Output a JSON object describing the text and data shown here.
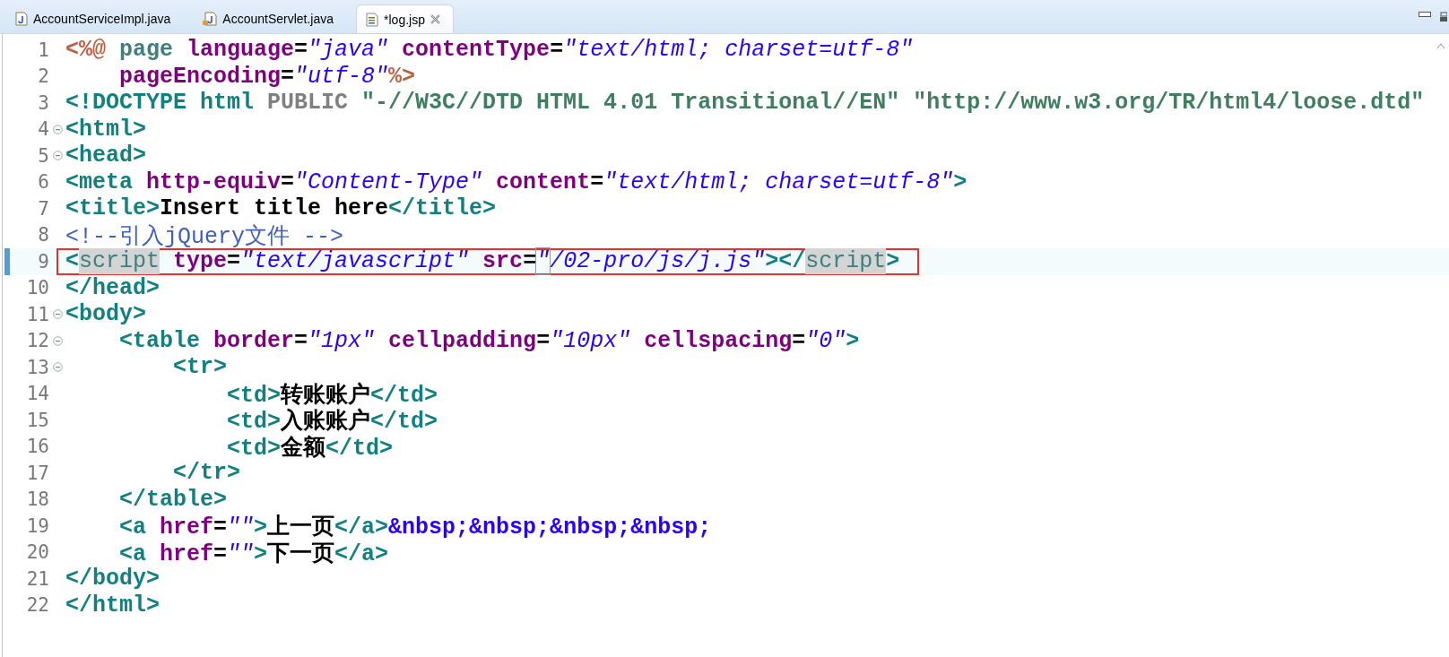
{
  "tabs": [
    {
      "label": "AccountServiceImpl.java",
      "kind": "java",
      "selected": false
    },
    {
      "label": "AccountServlet.java",
      "kind": "servlet",
      "selected": false
    },
    {
      "label": "*log.jsp",
      "kind": "jsp",
      "selected": true
    }
  ],
  "editor": {
    "lines": [
      {
        "number": "1",
        "collapsible": false,
        "current": false,
        "boxed": false,
        "tokens": [
          {
            "kind": "directive",
            "text": "<%@"
          },
          {
            "kind": "name",
            "text": " page"
          },
          {
            "kind": "attr",
            "text": " language"
          },
          {
            "kind": "punct",
            "text": "="
          },
          {
            "kind": "string",
            "text": "\"java\""
          },
          {
            "kind": "attr",
            "text": " contentType"
          },
          {
            "kind": "punct",
            "text": "="
          },
          {
            "kind": "string",
            "text": "\"text/html; charset=utf-8\""
          }
        ]
      },
      {
        "number": "2",
        "collapsible": false,
        "current": false,
        "boxed": false,
        "tokens": [
          {
            "kind": "attr",
            "text": "    pageEncoding"
          },
          {
            "kind": "punct",
            "text": "="
          },
          {
            "kind": "string",
            "text": "\"utf-8\""
          },
          {
            "kind": "directive",
            "text": "%>"
          }
        ]
      },
      {
        "number": "3",
        "collapsible": false,
        "current": false,
        "boxed": false,
        "tokens": [
          {
            "kind": "tag",
            "text": "<!DOCTYPE html"
          },
          {
            "kind": "keyword",
            "text": " PUBLIC"
          },
          {
            "kind": "doctype-string",
            "text": " \"-//W3C//DTD HTML 4.01 Transitional//EN\" \"http://www.w3.org/TR/html4/loose.dtd\""
          }
        ]
      },
      {
        "number": "4",
        "collapsible": true,
        "current": false,
        "boxed": false,
        "tokens": [
          {
            "kind": "tag",
            "text": "<html>"
          }
        ]
      },
      {
        "number": "5",
        "collapsible": true,
        "current": false,
        "boxed": false,
        "tokens": [
          {
            "kind": "tag",
            "text": "<head>"
          }
        ]
      },
      {
        "number": "6",
        "collapsible": false,
        "current": false,
        "boxed": false,
        "tokens": [
          {
            "kind": "tag",
            "text": "<meta"
          },
          {
            "kind": "attr",
            "text": " http-equiv"
          },
          {
            "kind": "punct",
            "text": "="
          },
          {
            "kind": "string",
            "text": "\"Content-Type\""
          },
          {
            "kind": "attr",
            "text": " content"
          },
          {
            "kind": "punct",
            "text": "="
          },
          {
            "kind": "string",
            "text": "\"text/html; charset=utf-8\""
          },
          {
            "kind": "tag",
            "text": ">"
          }
        ]
      },
      {
        "number": "7",
        "collapsible": false,
        "current": false,
        "boxed": false,
        "tokens": [
          {
            "kind": "tag",
            "text": "<title>"
          },
          {
            "kind": "text",
            "text": "Insert title here"
          },
          {
            "kind": "tag",
            "text": "</title>"
          }
        ]
      },
      {
        "number": "8",
        "collapsible": false,
        "current": false,
        "boxed": false,
        "tokens": [
          {
            "kind": "comment",
            "text": "<!--引入jQuery文件 -->"
          }
        ]
      },
      {
        "number": "9",
        "collapsible": false,
        "current": true,
        "boxed": true,
        "tokens": [
          {
            "kind": "tag",
            "text": "<"
          },
          {
            "kind": "occurrence",
            "text": "script"
          },
          {
            "kind": "attr",
            "text": " type"
          },
          {
            "kind": "punct",
            "text": "="
          },
          {
            "kind": "string",
            "text": "\"text/javascript\""
          },
          {
            "kind": "attr",
            "text": " src"
          },
          {
            "kind": "punct",
            "text": "="
          },
          {
            "kind": "bracket-match",
            "text": "\""
          },
          {
            "kind": "string",
            "text": "/02-pro/js/j.js\""
          },
          {
            "kind": "tag",
            "text": "></"
          },
          {
            "kind": "occurrence",
            "text": "script"
          },
          {
            "kind": "tag",
            "text": ">"
          }
        ]
      },
      {
        "number": "10",
        "collapsible": false,
        "current": false,
        "boxed": false,
        "tokens": [
          {
            "kind": "tag",
            "text": "</head>"
          }
        ]
      },
      {
        "number": "11",
        "collapsible": true,
        "current": false,
        "boxed": false,
        "tokens": [
          {
            "kind": "tag",
            "text": "<body>"
          }
        ]
      },
      {
        "number": "12",
        "collapsible": true,
        "current": false,
        "boxed": false,
        "tokens": [
          {
            "kind": "tag",
            "text": "    <table"
          },
          {
            "kind": "attr",
            "text": " border"
          },
          {
            "kind": "punct",
            "text": "="
          },
          {
            "kind": "string",
            "text": "\"1px\""
          },
          {
            "kind": "attr",
            "text": " cellpadding"
          },
          {
            "kind": "punct",
            "text": "="
          },
          {
            "kind": "string",
            "text": "\"10px\""
          },
          {
            "kind": "attr",
            "text": " cellspacing"
          },
          {
            "kind": "punct",
            "text": "="
          },
          {
            "kind": "string",
            "text": "\"0\""
          },
          {
            "kind": "tag",
            "text": ">"
          }
        ]
      },
      {
        "number": "13",
        "collapsible": true,
        "current": false,
        "boxed": false,
        "tokens": [
          {
            "kind": "tag",
            "text": "        <tr>"
          }
        ]
      },
      {
        "number": "14",
        "collapsible": false,
        "current": false,
        "boxed": false,
        "tokens": [
          {
            "kind": "tag",
            "text": "            <td>"
          },
          {
            "kind": "text",
            "text": "转账账户"
          },
          {
            "kind": "tag",
            "text": "</td>"
          }
        ]
      },
      {
        "number": "15",
        "collapsible": false,
        "current": false,
        "boxed": false,
        "tokens": [
          {
            "kind": "tag",
            "text": "            <td>"
          },
          {
            "kind": "text",
            "text": "入账账户"
          },
          {
            "kind": "tag",
            "text": "</td>"
          }
        ]
      },
      {
        "number": "16",
        "collapsible": false,
        "current": false,
        "boxed": false,
        "tokens": [
          {
            "kind": "tag",
            "text": "            <td>"
          },
          {
            "kind": "text",
            "text": "金额"
          },
          {
            "kind": "tag",
            "text": "</td>"
          }
        ]
      },
      {
        "number": "17",
        "collapsible": false,
        "current": false,
        "boxed": false,
        "tokens": [
          {
            "kind": "tag",
            "text": "        </tr>"
          }
        ]
      },
      {
        "number": "18",
        "collapsible": false,
        "current": false,
        "boxed": false,
        "tokens": [
          {
            "kind": "tag",
            "text": "    </table>"
          }
        ]
      },
      {
        "number": "19",
        "collapsible": false,
        "current": false,
        "boxed": false,
        "tokens": [
          {
            "kind": "tag",
            "text": "    <a"
          },
          {
            "kind": "attr",
            "text": " href"
          },
          {
            "kind": "punct",
            "text": "="
          },
          {
            "kind": "string",
            "text": "\"\""
          },
          {
            "kind": "tag",
            "text": ">"
          },
          {
            "kind": "text",
            "text": "上一页"
          },
          {
            "kind": "tag",
            "text": "</a>"
          },
          {
            "kind": "entity",
            "text": "&nbsp;&nbsp;&nbsp;&nbsp;"
          }
        ]
      },
      {
        "number": "20",
        "collapsible": false,
        "current": false,
        "boxed": false,
        "tokens": [
          {
            "kind": "tag",
            "text": "    <a"
          },
          {
            "kind": "attr",
            "text": " href"
          },
          {
            "kind": "punct",
            "text": "="
          },
          {
            "kind": "string",
            "text": "\"\""
          },
          {
            "kind": "tag",
            "text": ">"
          },
          {
            "kind": "text",
            "text": "下一页"
          },
          {
            "kind": "tag",
            "text": "</a>"
          }
        ]
      },
      {
        "number": "21",
        "collapsible": false,
        "current": false,
        "boxed": false,
        "tokens": [
          {
            "kind": "tag",
            "text": "</body>"
          }
        ]
      },
      {
        "number": "22",
        "collapsible": false,
        "current": false,
        "boxed": false,
        "tokens": [
          {
            "kind": "tag",
            "text": "</html>"
          }
        ]
      }
    ]
  }
}
